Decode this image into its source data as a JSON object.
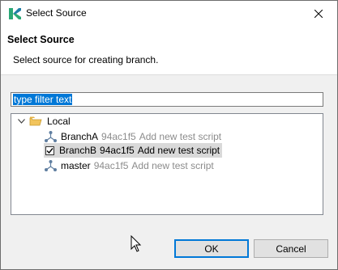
{
  "window": {
    "title": "Select Source"
  },
  "header": {
    "title": "Select Source",
    "description": "Select source for creating branch."
  },
  "filter": {
    "value": "type filter text"
  },
  "tree": {
    "root": {
      "label": "Local",
      "expanded": true
    },
    "branches": [
      {
        "name": "BranchA",
        "hash": "94ac1f5",
        "message": "Add new test script",
        "checked": false,
        "selected": false
      },
      {
        "name": "BranchB",
        "hash": "94ac1f5",
        "message": "Add new test script",
        "checked": true,
        "selected": true
      },
      {
        "name": "master",
        "hash": "94ac1f5",
        "message": "Add new test script",
        "checked": false,
        "selected": false
      }
    ]
  },
  "buttons": {
    "ok": "OK",
    "cancel": "Cancel"
  },
  "colors": {
    "accent": "#0078d7",
    "selection": "#d9d9d9",
    "dim_text": "#8c8c8c",
    "app_icon": "#2aa876"
  }
}
